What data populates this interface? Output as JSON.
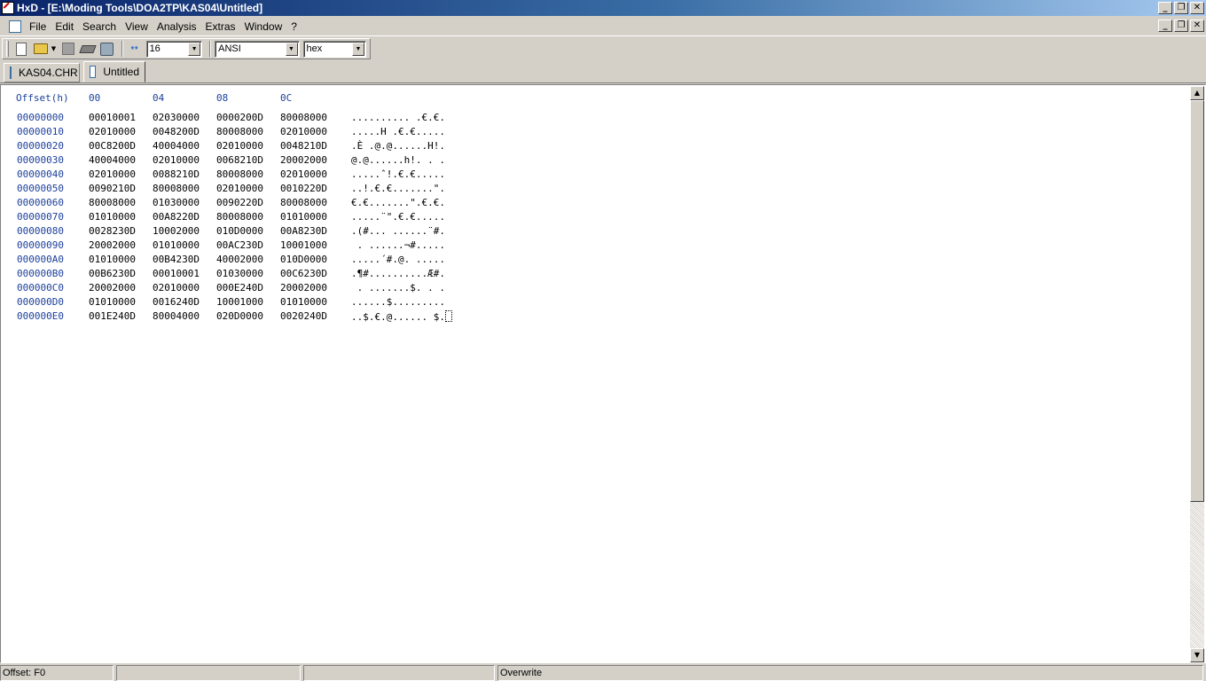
{
  "window": {
    "title": "HxD - [E:\\Moding Tools\\DOA2TP\\KAS04\\Untitled]",
    "caption_minimize": "_",
    "caption_maximize": "❐",
    "caption_close": "✕"
  },
  "menu": {
    "items": [
      "File",
      "Edit",
      "Search",
      "View",
      "Analysis",
      "Extras",
      "Window",
      "?"
    ]
  },
  "toolbar": {
    "bytes_per_row": "16",
    "charset": "ANSI",
    "offset_base": "hex",
    "icons": [
      "new-file-icon",
      "open-file-icon",
      "save-icon",
      "open-disk-icon",
      "open-ram-icon",
      "bytes-per-row-icon"
    ]
  },
  "tabs": [
    {
      "label": "KAS04.CHR",
      "active": false
    },
    {
      "label": "Untitled",
      "active": true
    }
  ],
  "hex": {
    "header": {
      "offset": "Offset(h)",
      "cols": [
        "00",
        "04",
        "08",
        "0C"
      ]
    },
    "rows": [
      {
        "offset": "00000000",
        "groups": [
          "00010001",
          "02030000",
          "0000200D",
          "80008000"
        ],
        "ascii": ".......... .€.€."
      },
      {
        "offset": "00000010",
        "groups": [
          "02010000",
          "0048200D",
          "80008000",
          "02010000"
        ],
        "ascii": ".....H .€.€....."
      },
      {
        "offset": "00000020",
        "groups": [
          "00C8200D",
          "40004000",
          "02010000",
          "0048210D"
        ],
        "ascii": ".È .@.@......H!."
      },
      {
        "offset": "00000030",
        "groups": [
          "40004000",
          "02010000",
          "0068210D",
          "20002000"
        ],
        "ascii": "@.@......h!. . ."
      },
      {
        "offset": "00000040",
        "groups": [
          "02010000",
          "0088210D",
          "80008000",
          "02010000"
        ],
        "ascii": ".....ˆ!.€.€....."
      },
      {
        "offset": "00000050",
        "groups": [
          "0090210D",
          "80008000",
          "02010000",
          "0010220D"
        ],
        "ascii": "..!.€.€.......\"."
      },
      {
        "offset": "00000060",
        "groups": [
          "80008000",
          "01030000",
          "0090220D",
          "80008000"
        ],
        "ascii": "€.€.......\".€.€."
      },
      {
        "offset": "00000070",
        "groups": [
          "01010000",
          "00A8220D",
          "80008000",
          "01010000"
        ],
        "ascii": ".....¨\".€.€....."
      },
      {
        "offset": "00000080",
        "groups": [
          "0028230D",
          "10002000",
          "010D0000",
          "00A8230D"
        ],
        "ascii": ".(#... ......¨#."
      },
      {
        "offset": "00000090",
        "groups": [
          "20002000",
          "01010000",
          "00AC230D",
          "10001000"
        ],
        "ascii": " . ......¬#....."
      },
      {
        "offset": "000000A0",
        "groups": [
          "01010000",
          "00B4230D",
          "40002000",
          "010D0000"
        ],
        "ascii": ".....´#.@. ....."
      },
      {
        "offset": "000000B0",
        "groups": [
          "00B6230D",
          "00010001",
          "01030000",
          "00C6230D"
        ],
        "ascii": ".¶#..........Æ#."
      },
      {
        "offset": "000000C0",
        "groups": [
          "20002000",
          "02010000",
          "000E240D",
          "20002000"
        ],
        "ascii": " . .......$. . ."
      },
      {
        "offset": "000000D0",
        "groups": [
          "01010000",
          "0016240D",
          "10001000",
          "01010000"
        ],
        "ascii": "......$........."
      },
      {
        "offset": "000000E0",
        "groups": [
          "001E240D",
          "80004000",
          "020D0000",
          "0020240D"
        ],
        "ascii": "..$.€.@...... $."
      }
    ]
  },
  "status": {
    "offset": "Offset: F0",
    "panel2": "",
    "panel3": "",
    "mode": "Overwrite"
  }
}
